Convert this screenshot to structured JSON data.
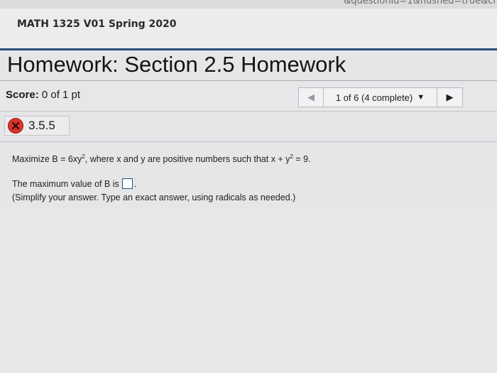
{
  "browser": {
    "url_fragment": "&questionId=1&flushed=true&cl"
  },
  "course": {
    "title": "MATH 1325 V01 Spring 2020"
  },
  "homework": {
    "title": "Homework: Section 2.5 Homework"
  },
  "score": {
    "label": "Score:",
    "value": "0 of 1 pt"
  },
  "navigation": {
    "prev_icon": "left-arrow-icon",
    "progress": "1 of 6 (4 complete)",
    "dropdown_icon": "caret-down-icon",
    "next_icon": "right-arrow-icon"
  },
  "question": {
    "number": "3.5.5",
    "status_icon": "x-circle-icon",
    "status_color": "#d9342b",
    "prompt_pre": "Maximize B = 6xy",
    "prompt_exp1": "2",
    "prompt_mid": ", where x and y are positive numbers such that x + y",
    "prompt_exp2": "2",
    "prompt_post": " = 9.",
    "answer_pre": "The maximum value of B is",
    "answer_post": ".",
    "hint": "(Simplify your answer. Type an exact answer, using radicals as needed.)"
  },
  "colors": {
    "accent_rule": "#2b4f78"
  }
}
